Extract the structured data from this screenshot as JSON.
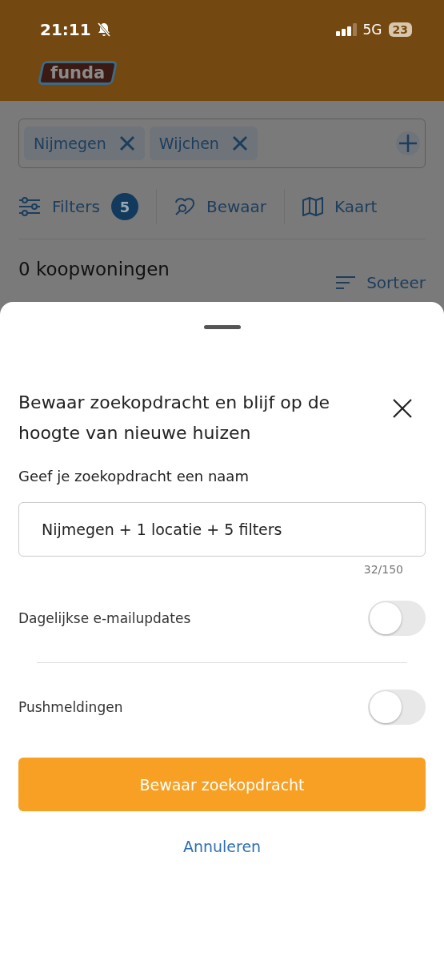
{
  "status_bar": {
    "time": "21:11",
    "network": "5G",
    "battery": "23"
  },
  "header": {
    "logo": "funda"
  },
  "search": {
    "chips": [
      {
        "label": "Nijmegen"
      },
      {
        "label": "Wijchen"
      }
    ]
  },
  "toolbar": {
    "filters": {
      "label": "Filters",
      "count": "5"
    },
    "save": {
      "label": "Bewaar"
    },
    "map": {
      "label": "Kaart"
    }
  },
  "results": {
    "title": "0 koopwoningen",
    "sort": "Sorteer"
  },
  "sheet": {
    "title": "Bewaar zoekopdracht en blijf op de hoogte van nieuwe huizen",
    "name_label": "Geef je zoekopdracht een naam",
    "name_value": "Nijmegen + 1 locatie + 5 filters",
    "counter": "32/150",
    "toggles": [
      {
        "label": "Dagelijkse e-mailupdates",
        "on": false
      },
      {
        "label": "Pushmeldingen",
        "on": false
      }
    ],
    "primary_button": "Bewaar zoekopdracht",
    "cancel": "Annuleren"
  }
}
